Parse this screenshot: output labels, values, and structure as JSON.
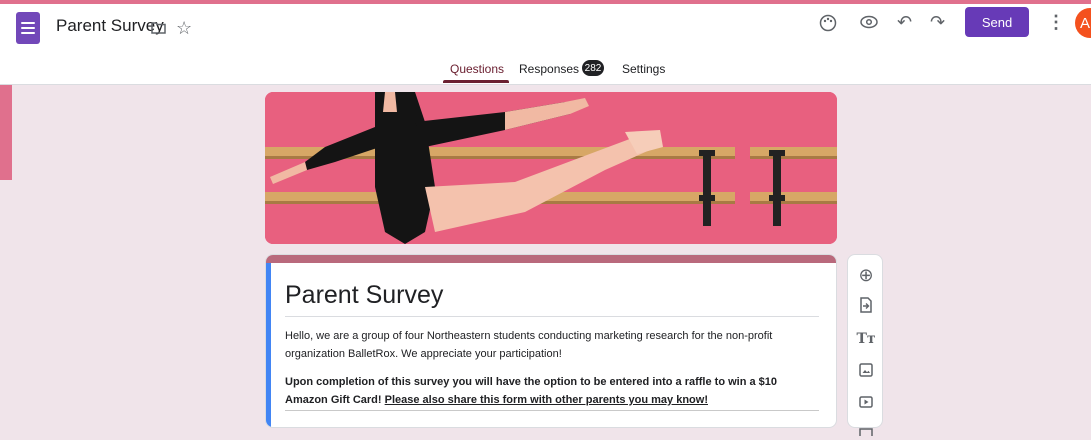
{
  "app": {
    "doc_title": "Parent Survey",
    "send_label": "Send",
    "avatar_initial": "A",
    "brand_color": "#673ab7"
  },
  "icons": {
    "folder": "὜0",
    "star": "☆",
    "palette": "❀",
    "preview": "◎",
    "undo": "↶",
    "redo": "↷",
    "more": "⋮"
  },
  "tabs": [
    {
      "label": "Questions",
      "active": true
    },
    {
      "label": "Responses",
      "badge": "282"
    },
    {
      "label": "Settings"
    }
  ],
  "form": {
    "title": "Parent Survey",
    "description": "Hello, we are a group of four Northeastern students conducting marketing research for the non-profit organization BalletRox. We appreciate your participation!",
    "raffle_text": "Upon completion of this survey you will have the option to be entered into a raffle to win a $10 Amazon Gift Card!",
    "share_text": "Please also share this form with other parents you may know!"
  },
  "toolbar": {
    "add_question": "⊕",
    "import_questions": "⇥",
    "title_text": "Tт"
  }
}
